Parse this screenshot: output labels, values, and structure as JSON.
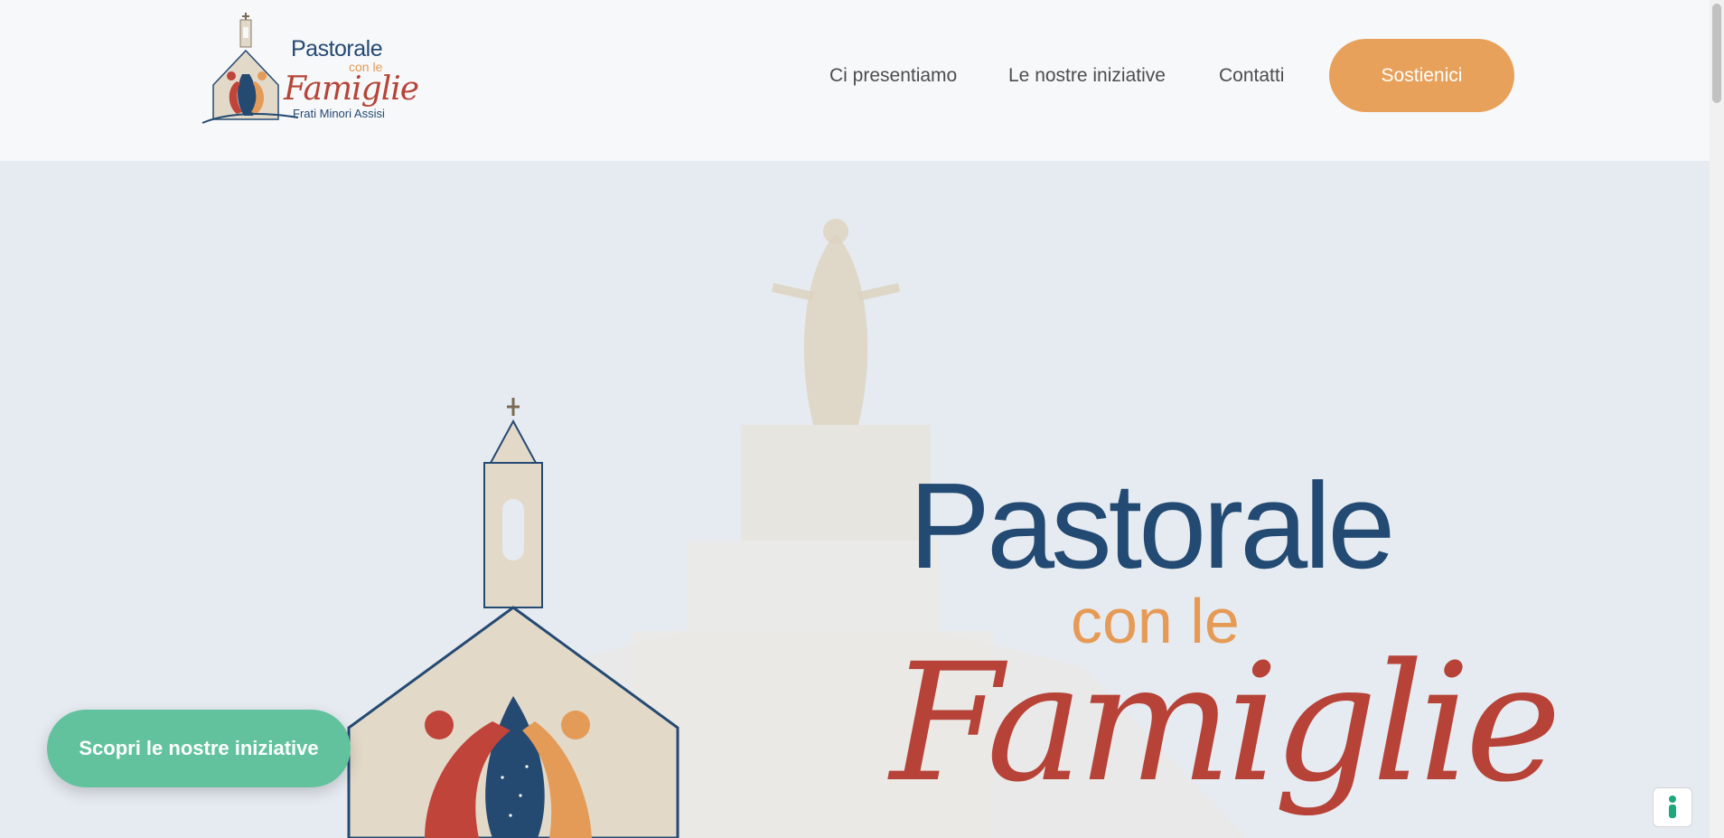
{
  "header": {
    "logo": {
      "line1": "Pastorale",
      "line2": "con le",
      "line3": "Famiglie",
      "line4": "Frati Minori Assisi"
    },
    "nav": [
      {
        "label": "Ci presentiamo"
      },
      {
        "label": "Le nostre iniziative"
      },
      {
        "label": "Contatti"
      }
    ],
    "donate_label": "Sostienici"
  },
  "hero": {
    "title_line1": "Pastorale",
    "title_line2": "con le",
    "title_line3": "Famiglie",
    "cta_label": "Scopri le nostre iniziative"
  },
  "colors": {
    "navy": "#234a72",
    "orange": "#e8a15a",
    "red": "#b74338",
    "green": "#62c29e"
  },
  "icons": {
    "accessibility": "accessibility-icon"
  }
}
